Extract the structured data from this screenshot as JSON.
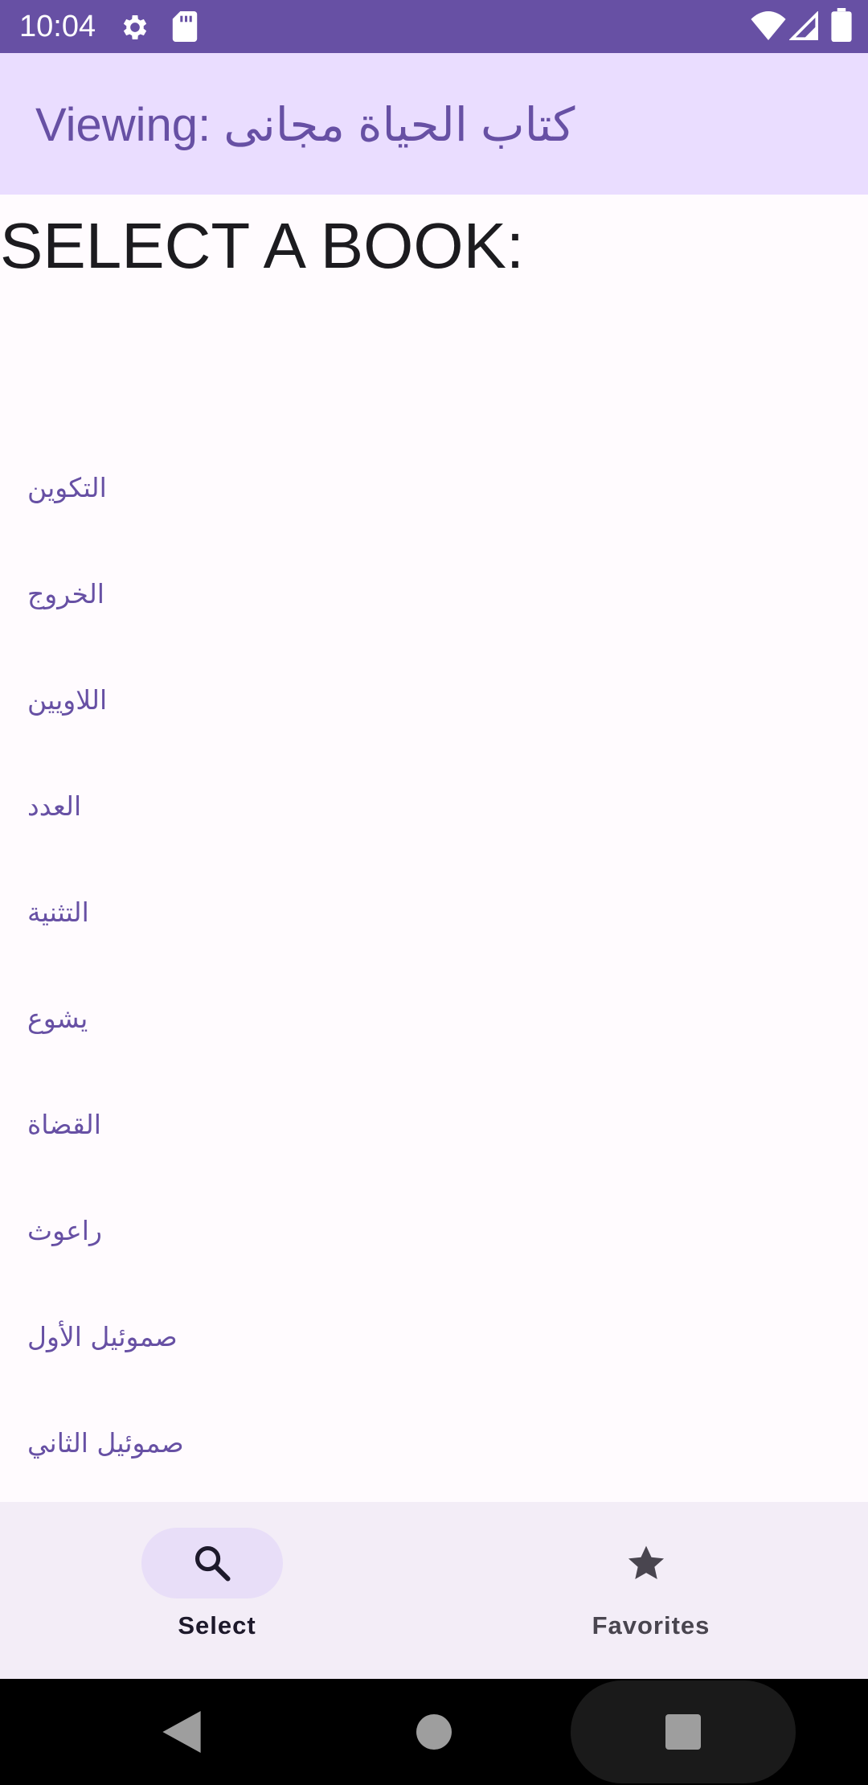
{
  "status_bar": {
    "time": "10:04",
    "icons": [
      "gear-icon",
      "sd-card-icon",
      "wifi-icon",
      "signal-icon",
      "battery-icon"
    ]
  },
  "app_bar": {
    "title": "Viewing: كتاب الحياة مجانى"
  },
  "main": {
    "heading": "SELECT A BOOK:",
    "books": [
      "التكوين",
      "الخروج",
      "اللاويين",
      "العدد",
      "التثنية",
      "يشوع",
      "القضاة",
      "راعوث",
      "صموئيل الأول",
      "صموئيل الثاني"
    ]
  },
  "bottom_nav": {
    "items": [
      {
        "label": "Select",
        "icon": "search-icon",
        "selected": true
      },
      {
        "label": "Favorites",
        "icon": "star-icon",
        "selected": false
      }
    ]
  },
  "system_nav": {
    "icons": [
      "back-icon",
      "home-icon",
      "recents-icon"
    ]
  },
  "colors": {
    "primary": "#6750a4",
    "app_bar_bg": "#eaddff",
    "surface": "#fffbfe",
    "nav_bg": "#f3edf7",
    "nav_indicator": "#e8def8"
  }
}
